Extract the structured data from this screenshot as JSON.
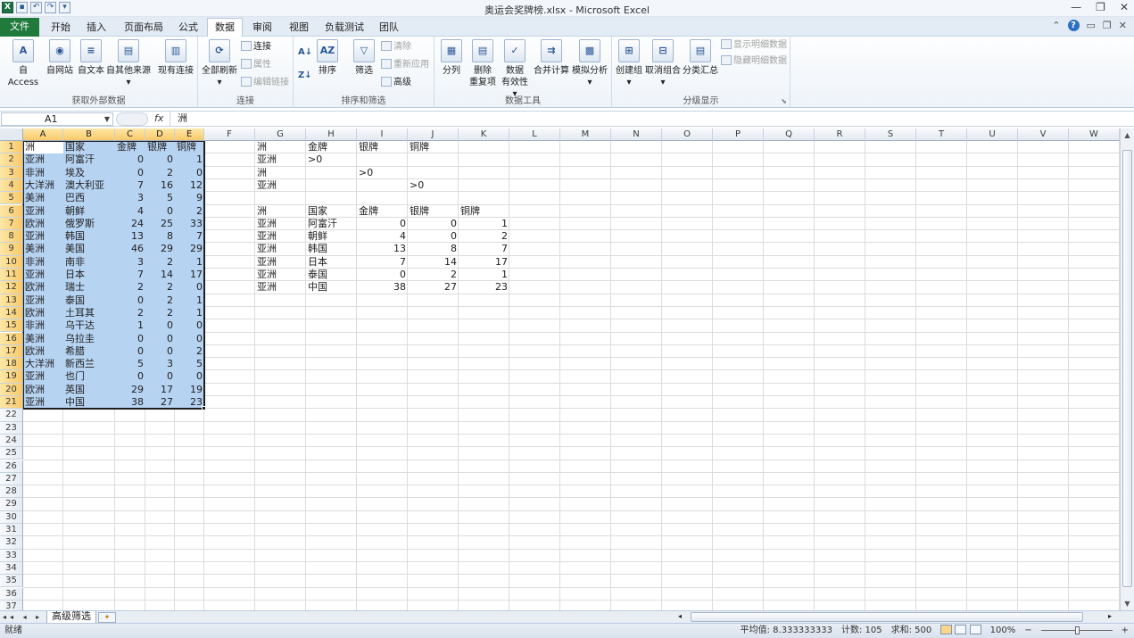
{
  "window": {
    "title": "奥运会奖牌榜.xlsx - Microsoft Excel",
    "controls": [
      "—",
      "❐",
      "✕"
    ]
  },
  "quick_access": [
    "X",
    "💾",
    "↶",
    "↷",
    "▾"
  ],
  "tabs": [
    "文件",
    "开始",
    "插入",
    "页面布局",
    "公式",
    "数据",
    "审阅",
    "视图",
    "负载测试",
    "团队"
  ],
  "active_tab": "数据",
  "ribbon": {
    "groups": {
      "get_external": {
        "label": "获取外部数据",
        "buttons": [
          "自 Access",
          "自网站",
          "自文本",
          "自其他来源",
          "现有连接"
        ]
      },
      "connections": {
        "label": "连接",
        "refresh_all": "全部刷新",
        "connections": "连接",
        "properties": "属性",
        "edit_links": "编辑链接"
      },
      "sort_filter": {
        "label": "排序和筛选",
        "sort": "排序",
        "filter": "筛选",
        "clear": "清除",
        "reapply": "重新应用",
        "advanced": "高级"
      },
      "data_tools": {
        "label": "数据工具",
        "split": "分列",
        "remove_dup_1": "删除",
        "remove_dup_2": "重复项",
        "validation_1": "数据",
        "validation_2": "有效性",
        "consolidate": "合并计算",
        "what_if": "模拟分析"
      },
      "outline": {
        "label": "分级显示",
        "group": "创建组",
        "ungroup": "取消组合",
        "subtotal": "分类汇总",
        "show_detail": "显示明细数据",
        "hide_detail": "隐藏明细数据"
      }
    }
  },
  "formula_bar": {
    "name_box": "A1",
    "fx": "fx",
    "value": "洲"
  },
  "columns": [
    "A",
    "B",
    "C",
    "D",
    "E",
    "F",
    "G",
    "H",
    "I",
    "J",
    "K",
    "L",
    "M",
    "N",
    "O",
    "P",
    "Q",
    "R",
    "S",
    "T",
    "U",
    "V",
    "W"
  ],
  "rows": [
    "1",
    "2",
    "3",
    "4",
    "5",
    "6",
    "7",
    "8",
    "9",
    "10",
    "11",
    "12",
    "13",
    "14",
    "15",
    "16",
    "17",
    "18",
    "19",
    "20",
    "21",
    "22",
    "23",
    "24",
    "25",
    "26",
    "27",
    "28",
    "29",
    "30",
    "31",
    "32",
    "33",
    "34",
    "35",
    "36",
    "37"
  ],
  "table_headers": [
    "洲",
    "国家",
    "金牌",
    "银牌",
    "铜牌"
  ],
  "table_rows": [
    [
      "亚洲",
      "阿富汗",
      "0",
      "0",
      "1"
    ],
    [
      "非洲",
      "埃及",
      "0",
      "2",
      "0"
    ],
    [
      "大洋洲",
      "澳大利亚",
      "7",
      "16",
      "12"
    ],
    [
      "美洲",
      "巴西",
      "3",
      "5",
      "9"
    ],
    [
      "亚洲",
      "朝鲜",
      "4",
      "0",
      "2"
    ],
    [
      "欧洲",
      "俄罗斯",
      "24",
      "25",
      "33"
    ],
    [
      "亚洲",
      "韩国",
      "13",
      "8",
      "7"
    ],
    [
      "美洲",
      "美国",
      "46",
      "29",
      "29"
    ],
    [
      "非洲",
      "南非",
      "3",
      "2",
      "1"
    ],
    [
      "亚洲",
      "日本",
      "7",
      "14",
      "17"
    ],
    [
      "欧洲",
      "瑞士",
      "2",
      "2",
      "0"
    ],
    [
      "亚洲",
      "泰国",
      "0",
      "2",
      "1"
    ],
    [
      "欧洲",
      "土耳其",
      "2",
      "2",
      "1"
    ],
    [
      "非洲",
      "乌干达",
      "1",
      "0",
      "0"
    ],
    [
      "美洲",
      "乌拉圭",
      "0",
      "0",
      "0"
    ],
    [
      "欧洲",
      "希腊",
      "0",
      "0",
      "2"
    ],
    [
      "大洋洲",
      "新西兰",
      "5",
      "3",
      "5"
    ],
    [
      "亚洲",
      "也门",
      "0",
      "0",
      "0"
    ],
    [
      "欧洲",
      "英国",
      "29",
      "17",
      "19"
    ],
    [
      "亚洲",
      "中国",
      "38",
      "27",
      "23"
    ]
  ],
  "criteria": {
    "headers": [
      "洲",
      "金牌",
      "银牌",
      "铜牌"
    ],
    "rows": [
      [
        "亚洲",
        ">0",
        "",
        ""
      ],
      [
        "洲",
        "",
        ">0",
        ""
      ],
      [
        "亚洲",
        "",
        "",
        ">0"
      ]
    ]
  },
  "result": {
    "headers": [
      "洲",
      "国家",
      "金牌",
      "银牌",
      "铜牌"
    ],
    "rows": [
      [
        "亚洲",
        "阿富汗",
        "0",
        "0",
        "1"
      ],
      [
        "亚洲",
        "朝鲜",
        "4",
        "0",
        "2"
      ],
      [
        "亚洲",
        "韩国",
        "13",
        "8",
        "7"
      ],
      [
        "亚洲",
        "日本",
        "7",
        "14",
        "17"
      ],
      [
        "亚洲",
        "泰国",
        "0",
        "2",
        "1"
      ],
      [
        "亚洲",
        "中国",
        "38",
        "27",
        "23"
      ]
    ]
  },
  "sheet": {
    "nav": "◂◂ ◂ ▸ ▸▸",
    "active_sheet": "高级筛选",
    "new_sheet_icon": "✦"
  },
  "status": {
    "ready": "就绪",
    "average": "平均值: 8.333333333",
    "count": "计数: 105",
    "sum": "求和: 500",
    "zoom": "100%",
    "zoom_minus": "−",
    "zoom_plus": "+"
  },
  "colors": {
    "file_tab": "#1f7a3c",
    "selection_fill": "#b7d3f2",
    "header_selected": "#f9c96a"
  }
}
